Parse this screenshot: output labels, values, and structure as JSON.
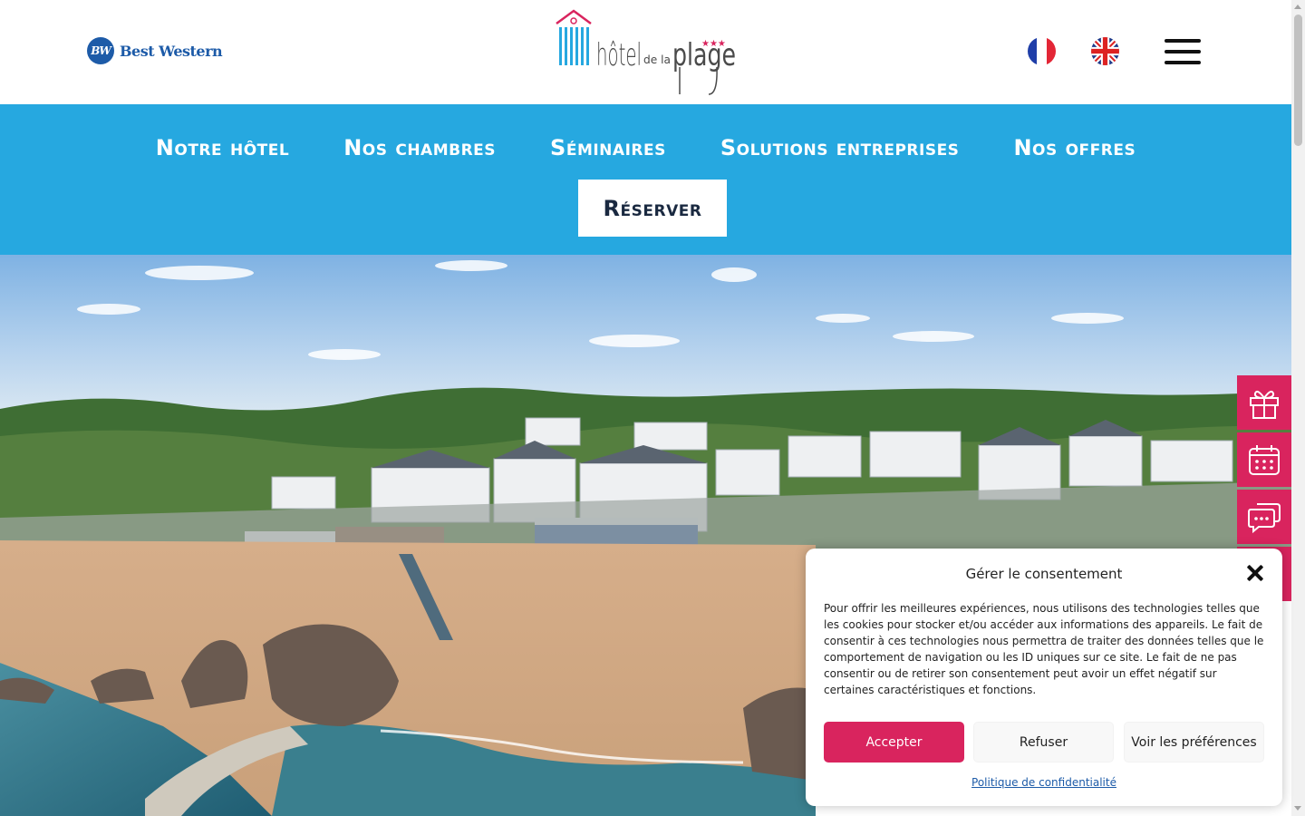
{
  "header": {
    "bw_logo_badge": "BW",
    "bw_logo_text": "Best Western",
    "hotel_logo": {
      "word1": "hôtel",
      "word2": "de la",
      "word3": "plage",
      "stars": "★★★"
    },
    "languages": [
      {
        "code": "fr",
        "icon": "france-flag-icon"
      },
      {
        "code": "en",
        "icon": "uk-flag-icon"
      }
    ],
    "menu_icon": "hamburger-menu-icon"
  },
  "nav": {
    "items": [
      {
        "label": "Notre hôtel"
      },
      {
        "label": "Nos chambres"
      },
      {
        "label": "Séminaires"
      },
      {
        "label": "Solutions entreprises"
      },
      {
        "label": "Nos offres"
      }
    ],
    "reserve_label": "Réserver"
  },
  "side_actions": [
    {
      "icon": "gift-icon"
    },
    {
      "icon": "calendar-icon"
    },
    {
      "icon": "chat-icon"
    }
  ],
  "consent": {
    "title": "Gérer le consentement",
    "text": "Pour offrir les meilleures expériences, nous utilisons des technologies telles que les cookies pour stocker et/ou accéder aux informations des appareils. Le fait de consentir à ces technologies nous permettra de traiter des données telles que le comportement de navigation ou les ID uniques sur ce site. Le fait de ne pas consentir ou de retirer son consentement peut avoir un effet négatif sur certaines caractéristiques et fonctions.",
    "accept_label": "Accepter",
    "refuse_label": "Refuser",
    "preferences_label": "Voir les préférences",
    "policy_link": "Politique de confidentialité"
  },
  "colors": {
    "nav_blue": "#26a8e0",
    "brand_pink": "#d9245e",
    "bw_blue": "#1d5ba8"
  }
}
